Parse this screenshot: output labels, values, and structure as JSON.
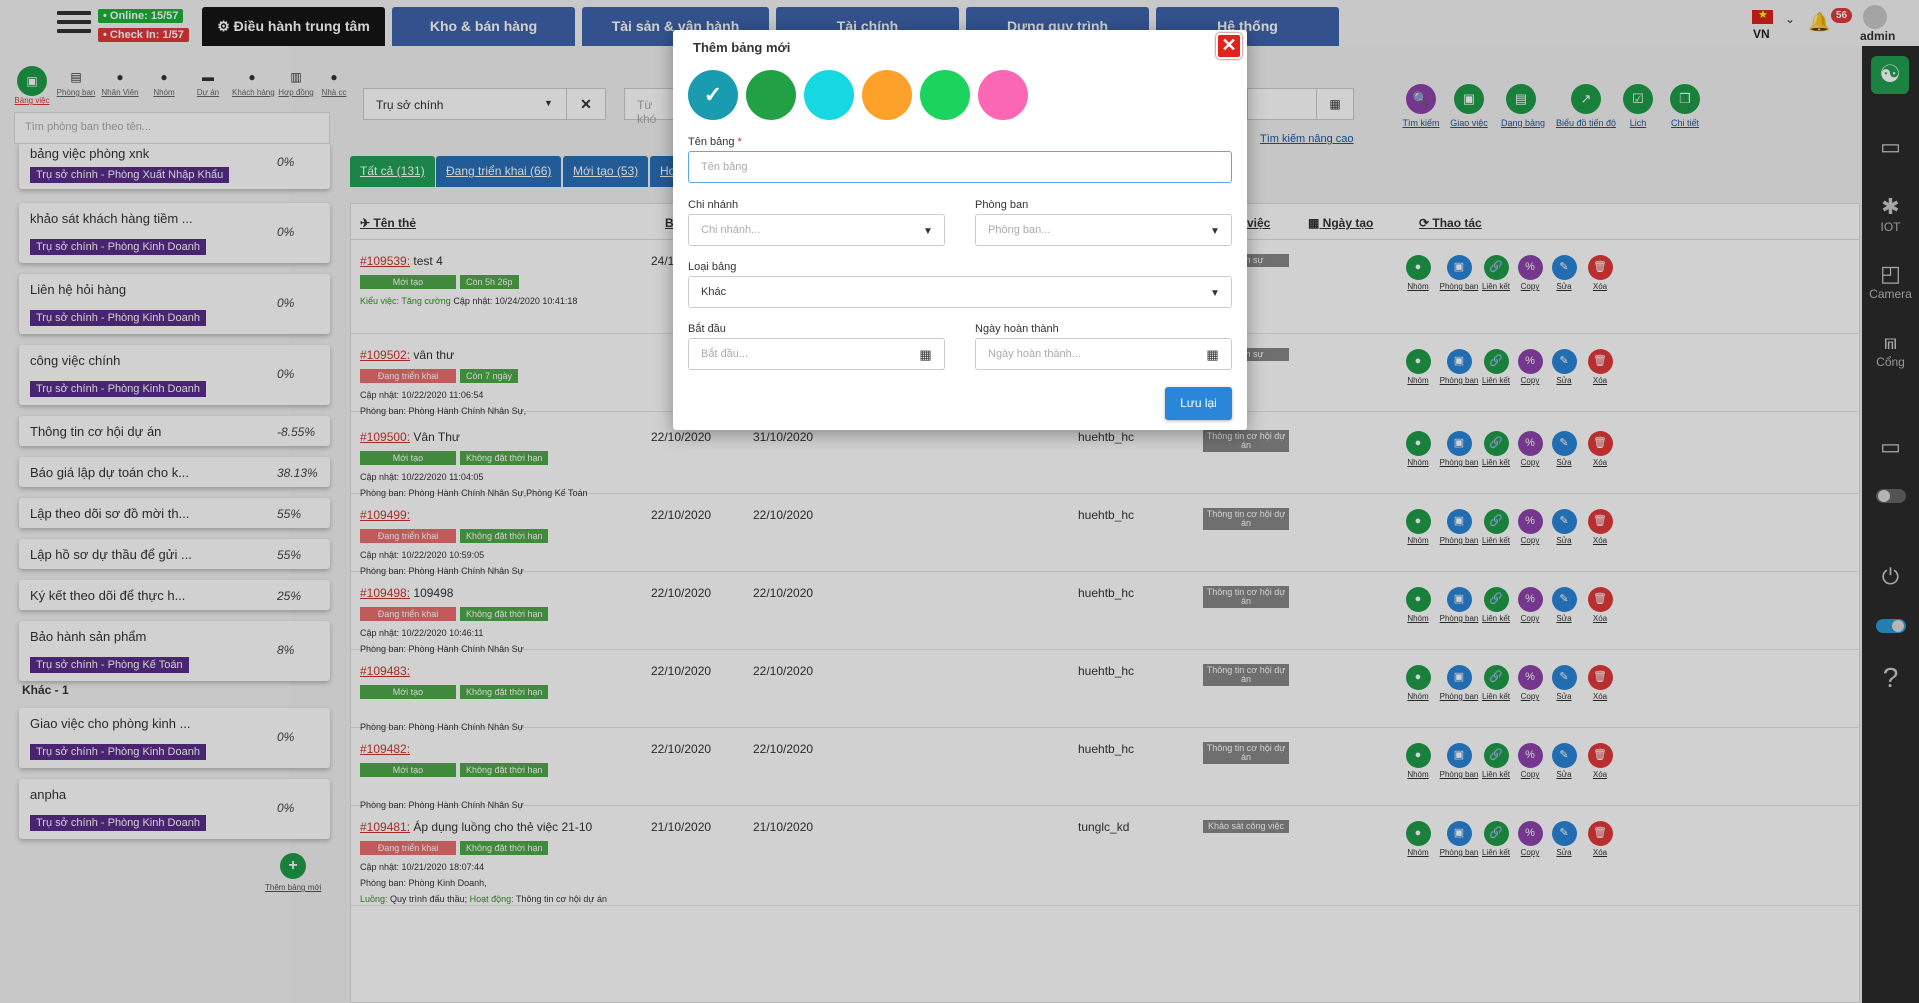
{
  "header": {
    "online": "• Online: 15/57",
    "checkin": "• Check In: 1/57",
    "tabs": [
      {
        "label": "⚙ Điều hành trung tâm"
      },
      {
        "label": "Kho & bán hàng"
      },
      {
        "label": "Tài sản & vận hành"
      },
      {
        "label": "Tài chính"
      },
      {
        "label": "Dựng quy trình"
      },
      {
        "label": "Hệ thống"
      }
    ],
    "language": "VN",
    "notifications": "56",
    "user": "admin"
  },
  "right_bar": {
    "items": [
      {
        "label": "IOT",
        "icon": "iot-icon"
      },
      {
        "label": "Camera",
        "icon": "camera-icon"
      },
      {
        "label": "Cổng",
        "icon": "gate-icon"
      }
    ]
  },
  "sidebar": {
    "icons": [
      {
        "label": "Bảng việc",
        "icon": "board-icon"
      },
      {
        "label": "Phòng ban",
        "icon": "department-icon"
      },
      {
        "label": "Nhân Viên",
        "icon": "employee-icon"
      },
      {
        "label": "Nhóm",
        "icon": "group-icon"
      },
      {
        "label": "Dự án",
        "icon": "project-icon"
      },
      {
        "label": "Khách hàng",
        "icon": "customer-icon"
      },
      {
        "label": "Hợp đồng",
        "icon": "contract-icon"
      },
      {
        "label": "Nhà cc",
        "icon": "supplier-icon"
      }
    ],
    "search_placeholder": "Tìm phòng ban theo tên...",
    "cards": [
      {
        "title": "bảng việc phòng xnk",
        "percent": "0%",
        "label": "Trụ sở chính - Phòng Xuất Nhập Khẩu"
      },
      {
        "title": "khảo sát khách hàng tiềm ...",
        "percent": "0%",
        "label": "Trụ sở chính - Phòng Kinh Doanh"
      },
      {
        "title": "Liên hệ hỏi hàng",
        "percent": "0%",
        "label": "Trụ sở chính - Phòng Kinh Doanh"
      },
      {
        "title": "công việc chính",
        "percent": "0%",
        "label": "Trụ sở chính - Phòng Kinh Doanh"
      },
      {
        "title": "Thông tin cơ hội dự án",
        "percent": "-8.55%"
      },
      {
        "title": "Báo giá lập dự toán cho k...",
        "percent": "38.13%"
      },
      {
        "title": "Lập theo dõi sơ đồ mời th...",
        "percent": "55%"
      },
      {
        "title": "Lập hồ sơ dự thầu để gửi ...",
        "percent": "55%"
      },
      {
        "title": "Ký kết theo dõi để thực h...",
        "percent": "25%"
      },
      {
        "title": "Bảo hành sản phẩm",
        "percent": "8%",
        "label": "Trụ sở chính - Phòng Kế Toán"
      },
      {
        "title": "Giao việc cho phòng kinh ...",
        "percent": "0%",
        "label": "Trụ sở chính - Phòng Kinh Doanh"
      },
      {
        "title": "anpha",
        "percent": "0%",
        "label": "Trụ sở chính - Phòng Kinh Doanh"
      }
    ],
    "group_label": "Khác - 1",
    "add_label": "Thêm bảng mới"
  },
  "filters": {
    "branch": "Trụ sở chính",
    "keyword_placeholder": "Từ khó",
    "advanced_search": "Tìm kiếm nâng cao"
  },
  "top_actions": [
    {
      "label": "Tìm kiếm",
      "icon": "search-icon",
      "color": "#8e44ad"
    },
    {
      "label": "Giao việc",
      "icon": "assign-icon",
      "color": "#1f9d4a"
    },
    {
      "label": "Dạng bảng",
      "icon": "table-view-icon",
      "color": "#1f9d4a"
    },
    {
      "label": "Biểu đồ tiến độ",
      "icon": "progress-chart-icon",
      "color": "#1f9d4a"
    },
    {
      "label": "Lịch",
      "icon": "calendar-icon",
      "color": "#1f9d4a"
    },
    {
      "label": "Chi tiết",
      "icon": "details-icon",
      "color": "#1f9d4a"
    }
  ],
  "filter_tabs": [
    {
      "label": "Tất cả (131)"
    },
    {
      "label": "Đang triển khai (66)"
    },
    {
      "label": "Mới tạo (53)"
    },
    {
      "label": "Ho"
    }
  ],
  "table": {
    "headers": {
      "name": "Tên thẻ",
      "b": "B",
      "type": "việc",
      "created": "Ngày tạo",
      "actions": "Thao tác"
    },
    "action_labels": [
      "Nhóm",
      "Phòng ban",
      "Liên kết",
      "Copy",
      "Sửa",
      "Xóa"
    ],
    "rows": [
      {
        "id": "#109539:",
        "name": " test 4",
        "status": "Mới tạo",
        "deadline": "Còn 5h 26p",
        "start": "24/1",
        "end": "",
        "user": "",
        "type": "chính sự",
        "sub": [
          {
            "k": "Kiểu việc: Tăng cường",
            "v": "  Cập nhật: 10/24/2020 10:41:18"
          }
        ]
      },
      {
        "id": "#109502:",
        "name": " vân thư",
        "status": "Đang triển khai",
        "deadline": "Còn 7 ngày",
        "start": "",
        "end": "",
        "user": "",
        "type": "chính sự",
        "sub": [
          {
            "v": "Cập nhật: 10/22/2020 11:06:54"
          },
          {
            "v": "Phòng ban: Phòng Hành Chính Nhân Sự,"
          }
        ]
      },
      {
        "id": "#109500:",
        "name": " Vân Thư",
        "status": "Mới tạo",
        "deadline": "Không đặt thời hạn",
        "start": "22/10/2020",
        "end": "31/10/2020",
        "user": "huehtb_hc",
        "type": "Thông tin cơ hội dự án",
        "sub": [
          {
            "v": "Cập nhật: 10/22/2020 11:04:05"
          },
          {
            "v": "Phòng ban: Phòng Hành Chính Nhân Sự,Phòng Kế Toán"
          }
        ]
      },
      {
        "id": "#109499:",
        "name": "",
        "status": "Đang triển khai",
        "deadline": "Không đặt thời hạn",
        "start": "22/10/2020",
        "end": "22/10/2020",
        "user": "huehtb_hc",
        "type": "Thông tin cơ hội dự án",
        "sub": [
          {
            "v": "Cập nhật: 10/22/2020 10:59:05"
          },
          {
            "v": "Phòng ban: Phòng Hành Chính Nhân Sự"
          }
        ]
      },
      {
        "id": "#109498:",
        "name": " 109498",
        "status": "Đang triển khai",
        "deadline": "Không đặt thời hạn",
        "start": "22/10/2020",
        "end": "22/10/2020",
        "user": "huehtb_hc",
        "type": "Thông tin cơ hội dự án",
        "sub": [
          {
            "v": "Cập nhật: 10/22/2020 10:46:11"
          },
          {
            "v": "Phòng ban: Phòng Hành Chính Nhân Sự"
          }
        ]
      },
      {
        "id": "#109483:",
        "name": "",
        "status": "Mới tạo",
        "deadline": "Không đặt thời hạn",
        "start": "22/10/2020",
        "end": "22/10/2020",
        "user": "huehtb_hc",
        "type": "Thông tin cơ hội dự án",
        "sub": [
          {
            "v": ""
          },
          {
            "v": "Phòng ban: Phòng Hành Chính Nhân Sự"
          }
        ]
      },
      {
        "id": "#109482:",
        "name": "",
        "status": "Mới tạo",
        "deadline": "Không đặt thời hạn",
        "start": "22/10/2020",
        "end": "22/10/2020",
        "user": "huehtb_hc",
        "type": "Thông tin cơ hội dự án",
        "sub": [
          {
            "v": ""
          },
          {
            "v": "Phòng ban: Phòng Hành Chính Nhân Sự"
          }
        ]
      },
      {
        "id": "#109481:",
        "name": " Áp dụng luồng cho thẻ việc 21-10",
        "status": "Đang triển khai",
        "deadline": "Không đặt thời hạn",
        "start": "21/10/2020",
        "end": "21/10/2020",
        "user": "tunglc_kd",
        "type": "Khảo sát công việc",
        "sub": [
          {
            "v": "Cập nhật: 10/21/2020 18:07:44"
          },
          {
            "v": "Phòng ban: Phòng Kinh Doanh,"
          },
          {
            "k": "Luồng:",
            "v": " Quy trình đấu thầu;  ",
            "k2": "Hoạt động:",
            "v2": " Thông tin cơ hội dự án"
          }
        ]
      }
    ]
  },
  "modal": {
    "title": "Thêm bảng mới",
    "colors": [
      "#199cb0",
      "#22a045",
      "#15d8e0",
      "#fda12b",
      "#1cd35e",
      "#fc67b4"
    ],
    "selected_color_index": 0,
    "name_label": "Tên bảng",
    "name_required": "*",
    "name_placeholder": "Tên bảng",
    "branch_label": "Chi nhánh",
    "branch_placeholder": "Chi nhánh...",
    "dept_label": "Phòng ban",
    "dept_placeholder": "Phòng ban...",
    "type_label": "Loại bảng",
    "type_value": "Khác",
    "start_label": "Bắt đầu",
    "start_placeholder": "Bắt đầu...",
    "end_label": "Ngày hoàn thành",
    "end_placeholder": "Ngày hoàn thành...",
    "save": "Lưu lại"
  }
}
